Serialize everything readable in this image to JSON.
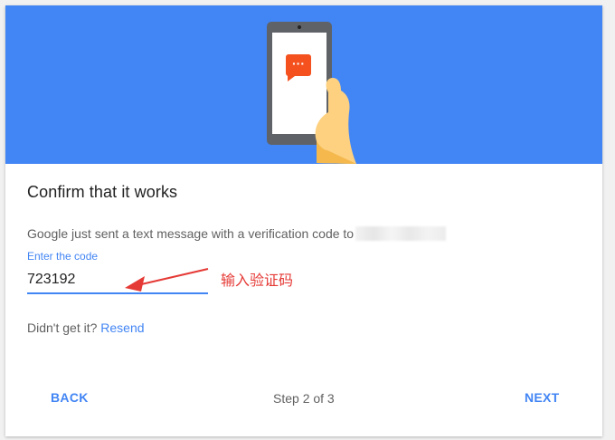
{
  "hero": {
    "background": "#4285f4",
    "illustration": "phone-with-message-icon",
    "message_glyph": "···"
  },
  "content": {
    "title": "Confirm that it works",
    "message": "Google just sent a text message with a verification code to"
  },
  "code_field": {
    "label": "Enter the code",
    "value": "723192"
  },
  "annotation": {
    "text": "输入验证码",
    "color": "#e53935"
  },
  "resend": {
    "prompt": "Didn't get it?",
    "link": "Resend"
  },
  "footer": {
    "back_label": "BACK",
    "step_text": "Step 2 of 3",
    "next_label": "NEXT"
  },
  "colors": {
    "accent": "#4285f4",
    "text_primary": "#212121",
    "text_secondary": "#616161"
  }
}
